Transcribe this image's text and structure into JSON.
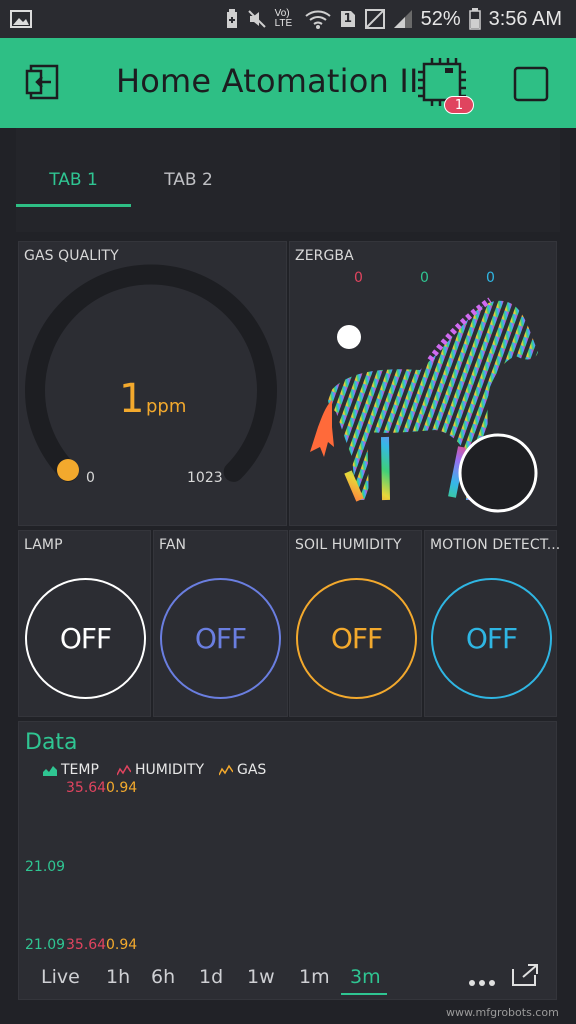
{
  "status_bar": {
    "battery_percent": "52%",
    "time": "3:56 AM",
    "volte": "Vo) LTE",
    "sim_badge": "1"
  },
  "app_bar": {
    "title": "Home Atomation II",
    "device_badge": "1",
    "accent_color": "#2ebf85"
  },
  "tabs": [
    {
      "label": "TAB 1",
      "active": true
    },
    {
      "label": "TAB 2",
      "active": false
    }
  ],
  "gauge": {
    "label": "GAS QUALITY",
    "value": "1",
    "unit": "ppm",
    "min": "0",
    "max": "1023",
    "fraction": 0.001,
    "color": "#f3a92d"
  },
  "zergba": {
    "label": "ZERGBA",
    "r": "0",
    "g": "0",
    "b": "0"
  },
  "buttons": [
    {
      "label": "LAMP",
      "state": "OFF",
      "color": "#ffffff"
    },
    {
      "label": "FAN",
      "state": "OFF",
      "color": "#6a7ee0"
    },
    {
      "label": "SOIL HUMIDITY",
      "state": "OFF",
      "color": "#f3a92d"
    },
    {
      "label": "MOTION DETECT...",
      "state": "OFF",
      "color": "#2fb6e3"
    }
  ],
  "chart": {
    "title": "Data",
    "legend": [
      {
        "name": "TEMP",
        "color": "#2fc592"
      },
      {
        "name": "HUMIDITY",
        "color": "#e0445f"
      },
      {
        "name": "GAS",
        "color": "#f3a92d"
      }
    ],
    "top_values": {
      "humidity": "35.64",
      "gas": "0.94"
    },
    "mid_value": "21.09",
    "bottom_values": {
      "temp": "21.09",
      "humidity": "35.64",
      "gas": "0.94"
    },
    "ranges": [
      "Live",
      "1h",
      "6h",
      "1d",
      "1w",
      "1m",
      "3m"
    ],
    "active_range": "3m"
  },
  "watermark": "www.mfgrobots.com"
}
